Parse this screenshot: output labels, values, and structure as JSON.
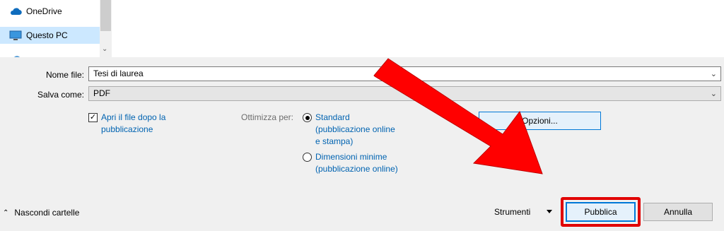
{
  "nav": {
    "items": [
      {
        "label": "OneDrive",
        "icon": "cloud-icon"
      },
      {
        "label": "Questo PC",
        "icon": "computer-icon",
        "selected": true
      }
    ]
  },
  "form": {
    "file_name_label": "Nome file:",
    "file_name_value": "Tesi di laurea",
    "save_as_label": "Salva come:",
    "save_as_value": "PDF"
  },
  "options": {
    "open_after_label_line1": "Apri il file dopo la",
    "open_after_label_line2": "pubblicazione",
    "open_after_checked": true,
    "optimize_label": "Ottimizza per:",
    "standard_line1": "Standard",
    "standard_line2": "(pubblicazione online",
    "standard_line3": "e stampa)",
    "minimum_line1": "Dimensioni minime",
    "minimum_line2": "(pubblicazione online)",
    "selected_option": "standard",
    "options_button": "Opzioni..."
  },
  "footer": {
    "hide_folders": "Nascondi cartelle",
    "tools": "Strumenti",
    "publish": "Pubblica",
    "cancel": "Annulla"
  },
  "colors": {
    "accent_blue": "#0063b1",
    "annotation_red": "#e10000"
  }
}
